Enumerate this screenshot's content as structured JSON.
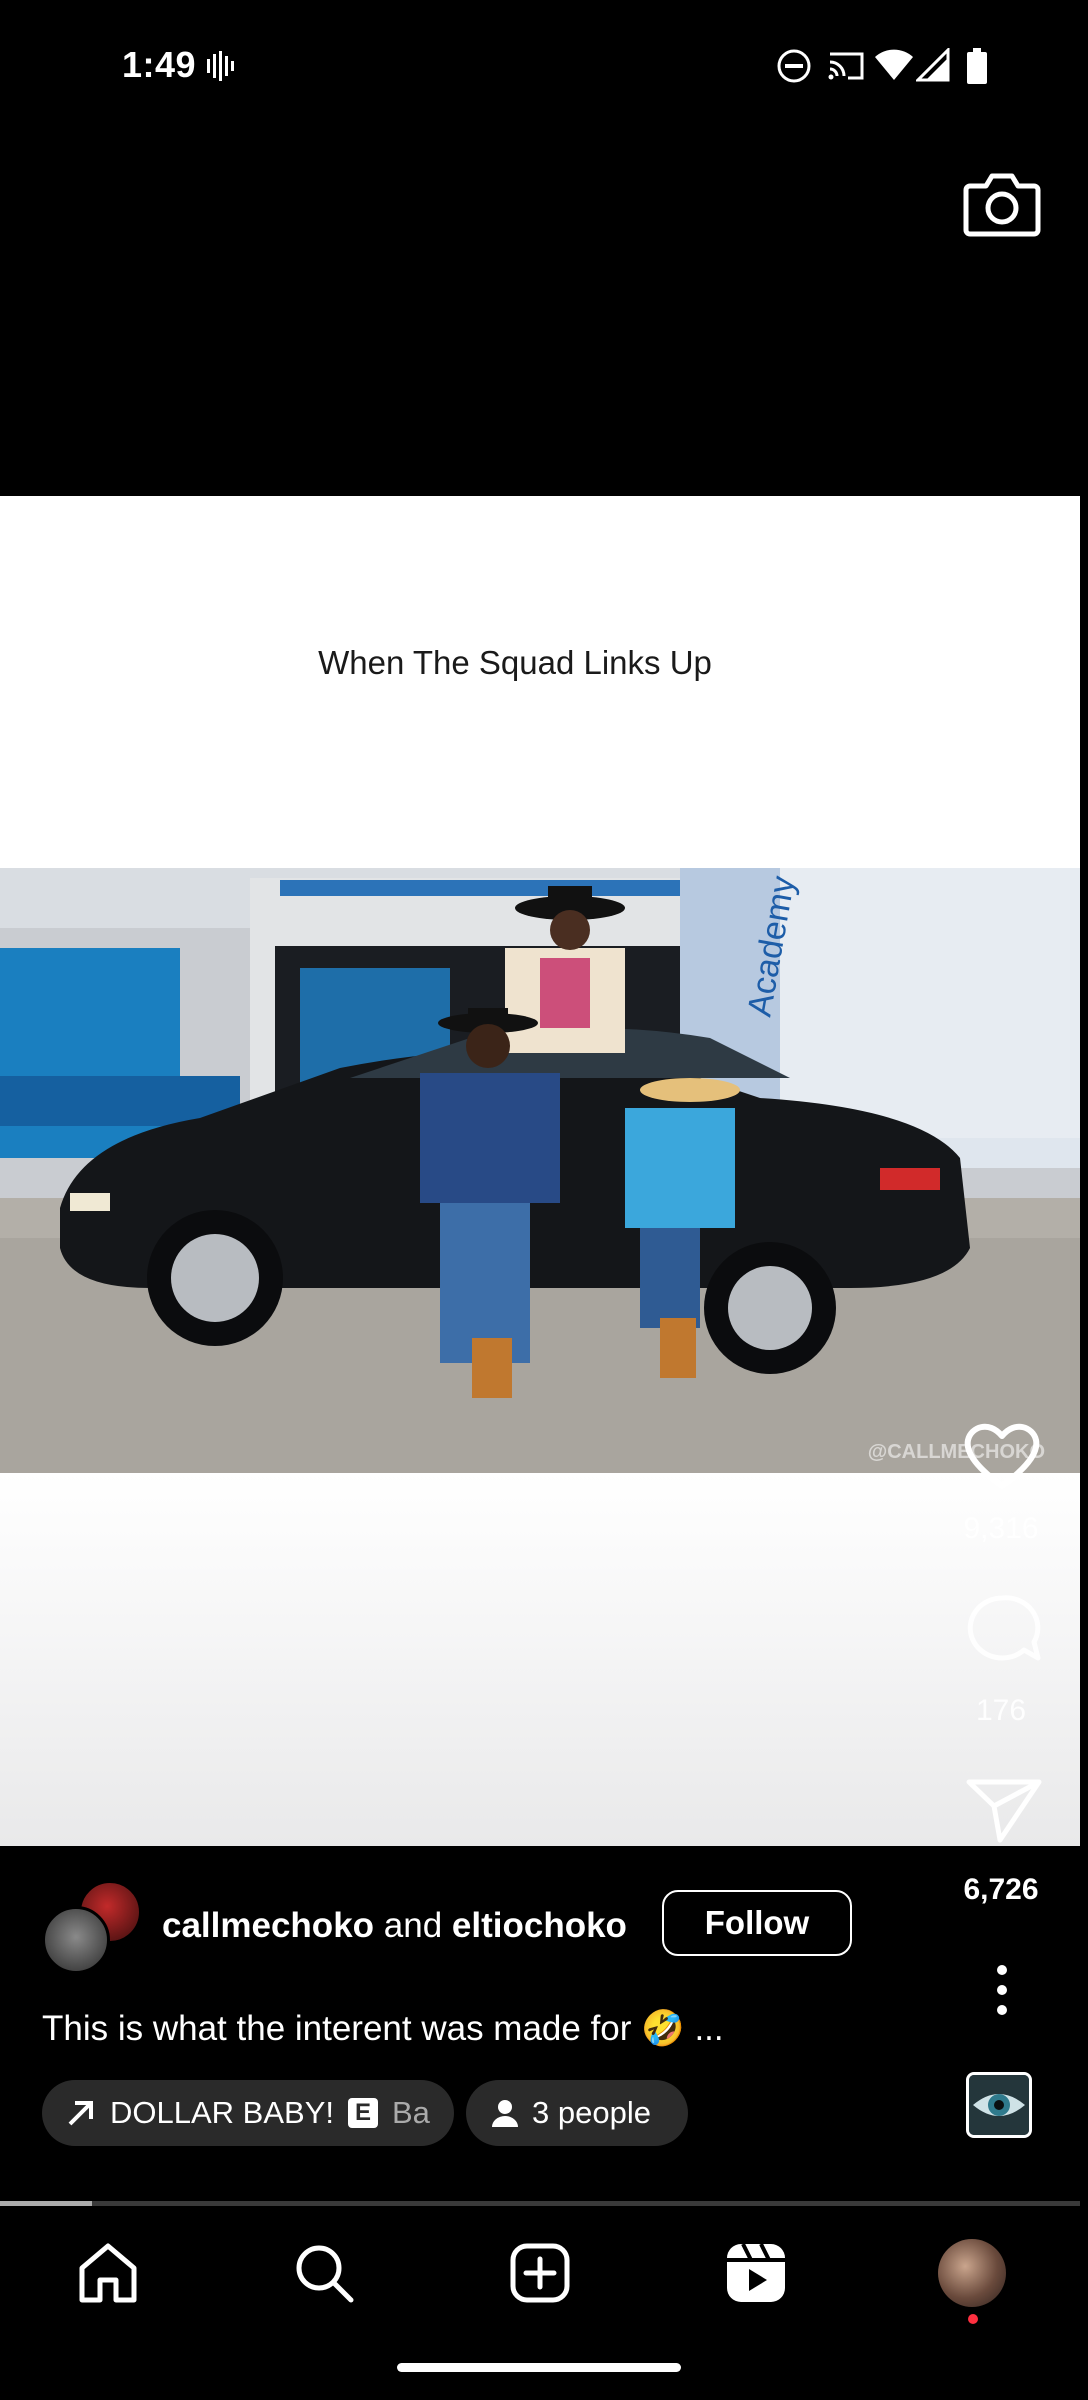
{
  "status_bar": {
    "time": "1:49",
    "icons": [
      "vibrate-icon",
      "do-not-disturb-icon",
      "cast-icon",
      "wifi-icon",
      "signal-icon",
      "battery-icon"
    ]
  },
  "video": {
    "caption_text": "When The Squad Links Up",
    "watermark": "@CALLMECHOKO"
  },
  "actions": {
    "like_count": "9,316",
    "comment_count": "176",
    "share_count": "6,726"
  },
  "post": {
    "author1": "callmechoko",
    "joiner": "and",
    "author2": "eltiochoko",
    "follow_label": "Follow",
    "caption": "This is what the interent was made for 🤣 ...",
    "audio_title": "DOLLAR BABY!",
    "audio_badge": "E",
    "audio_more": "Ba",
    "people_label": "3 people"
  },
  "playback": {
    "progress": 0.085
  },
  "nav": {
    "items": [
      "home-icon",
      "search-icon",
      "create-icon",
      "reels-icon",
      "profile-avatar"
    ],
    "notification_color": "#ff3040"
  }
}
